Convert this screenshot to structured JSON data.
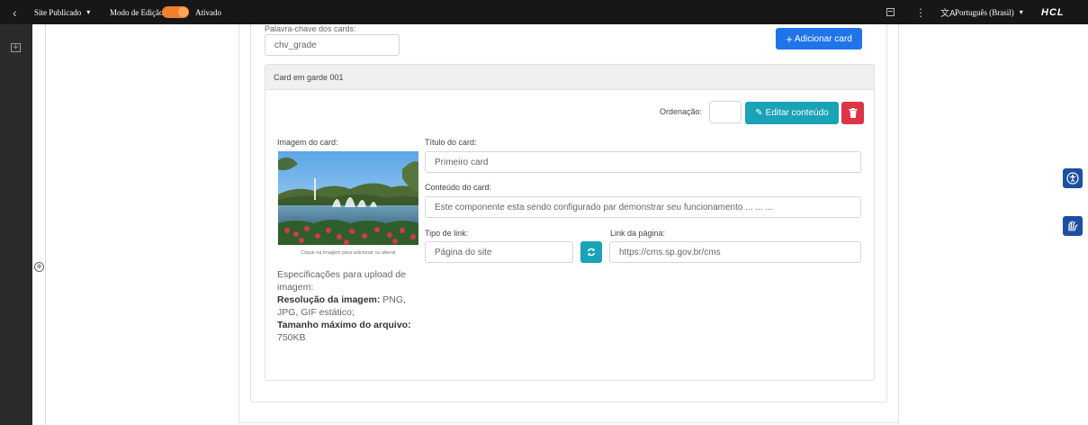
{
  "topbar": {
    "back_glyph": "‹",
    "published_label": "Site Publicado",
    "caret": "▾",
    "edit_mode_label": "Modo de Edição:",
    "edit_mode_state": "Ativado",
    "kebab_glyph": "⋮",
    "language_icon_glyph": "文A",
    "language_label": "Português (Brasil)",
    "logo_text": "HCL",
    "toggle_on": true,
    "toggle_color": "#f07f2d"
  },
  "rail": {
    "add_icon_glyph": "+",
    "expand_glyph": "⊕"
  },
  "form": {
    "keyword_label": "Palavra-chave dos cards:",
    "keyword_value": "chv_grade",
    "add_card_label": "Adicionar card",
    "add_card_glyph": "+"
  },
  "card": {
    "header_title": "Card em garde 001",
    "order_label": "Ordenação:",
    "order_value": "",
    "edit_content_label": "Editar conteúdo",
    "edit_glyph": "✎",
    "image_label": "Imagem do card:",
    "image_hint": "Clique na imagem para adicionar ou alterar",
    "specs_intro": "Especificações para upload de imagem:",
    "specs_resolution_label": "Resolução da imagem:",
    "specs_resolution_value": "PNG, JPG, GIF estático;",
    "specs_size_label": "Tamanho máximo do arquivo:",
    "specs_size_value": "750KB",
    "title_label": "Título do card:",
    "title_value": "Primeiro card",
    "content_label": "Conteúdo do card:",
    "content_value": "Este componente esta sendo configurado par demonstrar seu funcionamento ... ... ...",
    "link_type_label": "Tipo de link:",
    "link_type_value": "Página do site",
    "page_link_label": "Link da página:",
    "page_link_value": "https://cms.sp.gov.br/cms"
  },
  "colors": {
    "primary_blue": "#1f74ea",
    "info_teal": "#1aa2b7",
    "danger_red": "#dc3545",
    "accessibility_blue": "#1d4fa1"
  }
}
